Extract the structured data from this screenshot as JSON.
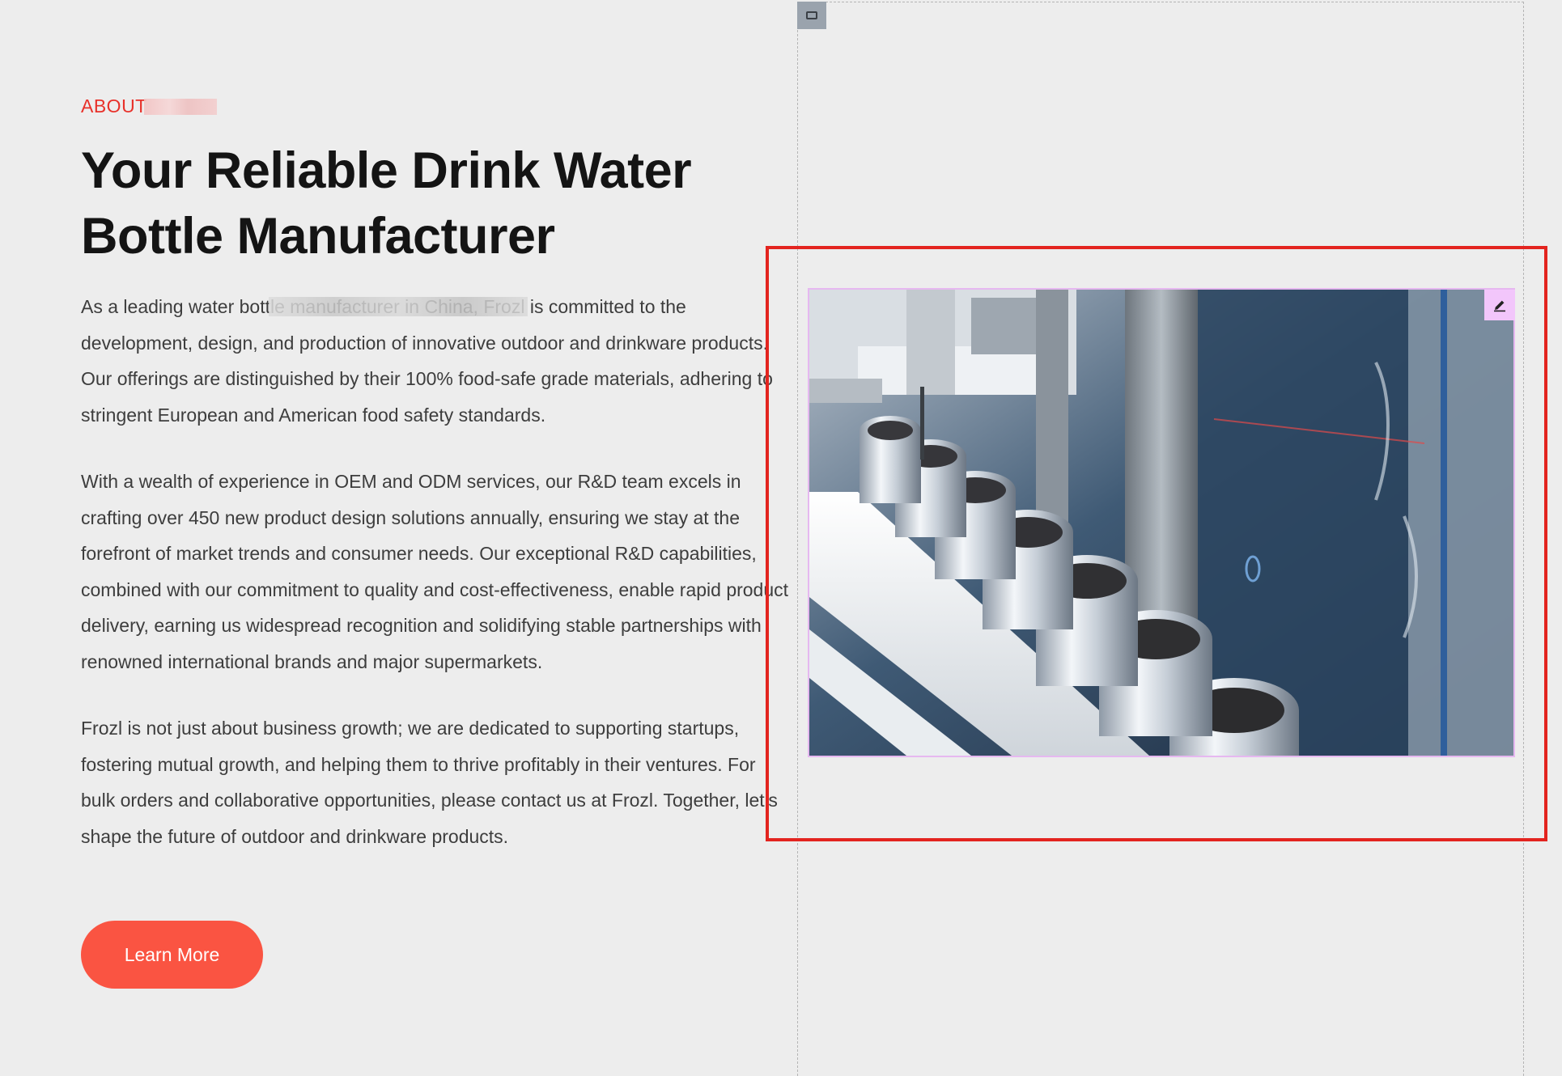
{
  "about": {
    "eyebrow": "ABOUT"
  },
  "headline": "Your Reliable Drink Water Bottle Manufacturer",
  "paragraphs": [
    "As a leading water bottle manufacturer in China, Frozl is committed to the development, design, and production of innovative outdoor and drinkware products. Our offerings are distinguished by their 100% food-safe grade materials, adhering to stringent European and American food safety standards.",
    "With a wealth of experience in OEM and ODM services, our R&D team excels in crafting over 450 new product design solutions annually, ensuring we stay at the forefront of market trends and consumer needs. Our exceptional R&D capabilities, combined with our commitment to quality and cost-effectiveness, enable rapid product delivery, earning us widespread recognition and solidifying stable partnerships with renowned international brands and major supermarkets.",
    "Frozl is not just about business growth; we are dedicated to supporting startups, fostering mutual growth, and helping them to thrive profitably in their ventures. For bulk orders and collaborative opportunities, please contact us at Frozl. Together, let’s shape the future of outdoor and drinkware products."
  ],
  "cta": {
    "label": "Learn More"
  },
  "editor": {
    "block_icon": "block-layout-icon",
    "edit_icon": "pencil-icon",
    "image_icon": "can-production-line-photo"
  },
  "colors": {
    "accent": "#e8312a",
    "cta_bg": "#fa5442",
    "highlight": "#e3241f",
    "image_outline": "#e6b8f0",
    "edit_button_bg": "#f2c6fb"
  }
}
